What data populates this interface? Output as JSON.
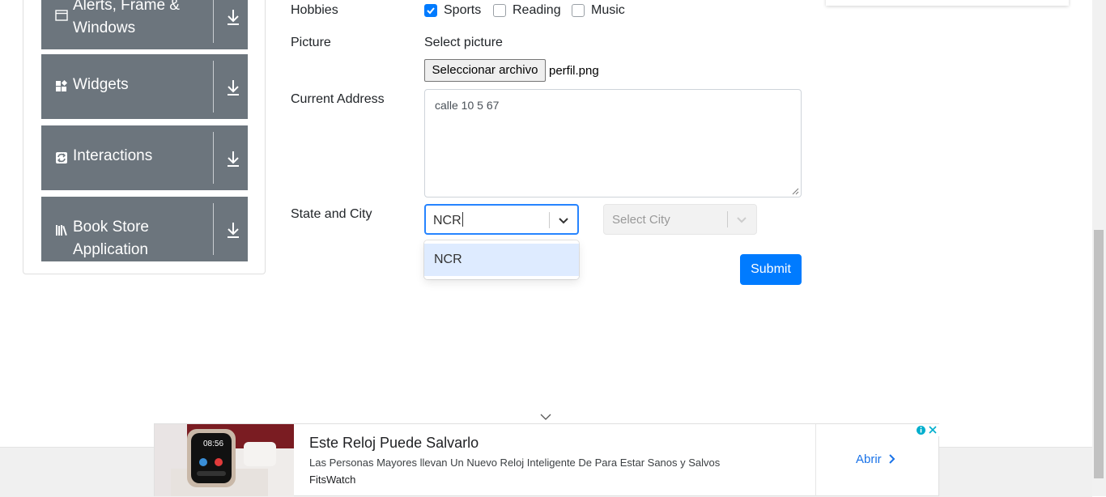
{
  "sidebar": {
    "groups": [
      {
        "title_line1": "Alerts, Frame &",
        "title_line2": "Windows",
        "icon": "window-icon"
      },
      {
        "title": "Widgets",
        "icon": "widgets-icon"
      },
      {
        "title": "Interactions",
        "icon": "interactions-icon"
      },
      {
        "title_line1": "Book Store",
        "title_line2": "Application",
        "icon": "books-icon"
      }
    ]
  },
  "form": {
    "hobbies": {
      "label": "Hobbies",
      "options": [
        {
          "label": "Sports",
          "checked": true
        },
        {
          "label": "Reading",
          "checked": false
        },
        {
          "label": "Music",
          "checked": false
        }
      ]
    },
    "picture": {
      "label": "Picture",
      "hint": "Select picture",
      "button": "Seleccionar archivo",
      "file_name": "perfil.png"
    },
    "address": {
      "label": "Current Address",
      "value": "calle 10 5 67"
    },
    "state_city": {
      "label": "State and City",
      "state_value": "NCR",
      "state_option": "NCR",
      "city_placeholder": "Select City"
    },
    "submit": "Submit"
  },
  "ad": {
    "title": "Este Reloj Puede Salvarlo",
    "description": "Las Personas Mayores llevan Un Nuevo Reloj Inteligente De Para Estar Sanos y Salvos",
    "brand": "FitsWatch",
    "cta": "Abrir",
    "watch_time": "08:56"
  },
  "colors": {
    "sidebar_bg": "#6c757d",
    "primary": "#007bff",
    "select_focus": "#2684ff",
    "option_highlight": "#deebff",
    "ad_link": "#1a73e8"
  }
}
